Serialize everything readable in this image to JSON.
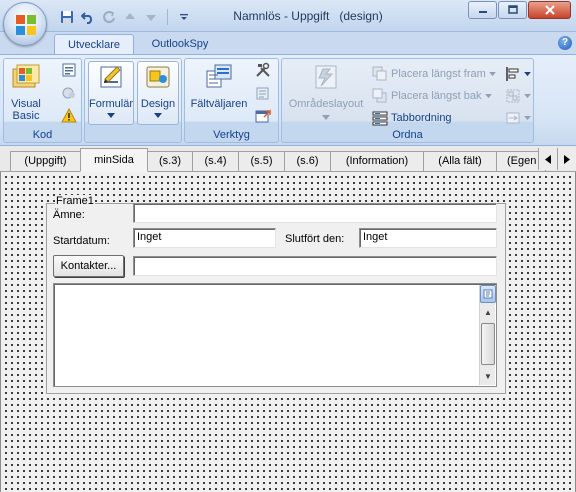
{
  "window": {
    "title": "Namnlös - Uppgift",
    "mode": "(design)"
  },
  "ribbon": {
    "tabs": [
      {
        "label": "Utvecklare",
        "active": true
      },
      {
        "label": "OutlookSpy",
        "active": false
      }
    ],
    "groups": {
      "kod": {
        "label": "Kod",
        "visual_basic_label": "Visual\nBasic"
      },
      "design": {
        "formular_label": "Formulär",
        "design_label": "Design"
      },
      "verktyg": {
        "label": "Verktyg",
        "faltvaljaren_label": "Fältväljaren"
      },
      "ordna": {
        "label": "Ordna",
        "omradeslayout_label": "Områdeslayout",
        "placera_fram_label": "Placera längst fram",
        "placera_bak_label": "Placera längst bak",
        "tabbordning_label": "Tabbordning"
      }
    }
  },
  "page_tabs": [
    {
      "label": "(Uppgift)",
      "active": false
    },
    {
      "label": "minSida",
      "active": true
    },
    {
      "label": "(s.3)",
      "active": false
    },
    {
      "label": "(s.4)",
      "active": false
    },
    {
      "label": "(s.5)",
      "active": false
    },
    {
      "label": "(s.6)",
      "active": false
    },
    {
      "label": "(Information)",
      "active": false
    },
    {
      "label": "(Alla fält)",
      "active": false
    },
    {
      "label": "(Egen",
      "active": false
    }
  ],
  "form": {
    "frame_label": "Frame1",
    "amne_label": "Ämne:",
    "amne_value": "",
    "startdatum_label": "Startdatum:",
    "startdatum_value": "Inget",
    "slutfort_label": "Slutfört den:",
    "slutfort_value": "Inget",
    "kontakter_button": "Kontakter...",
    "kontakter_value": "",
    "memo_value": ""
  }
}
